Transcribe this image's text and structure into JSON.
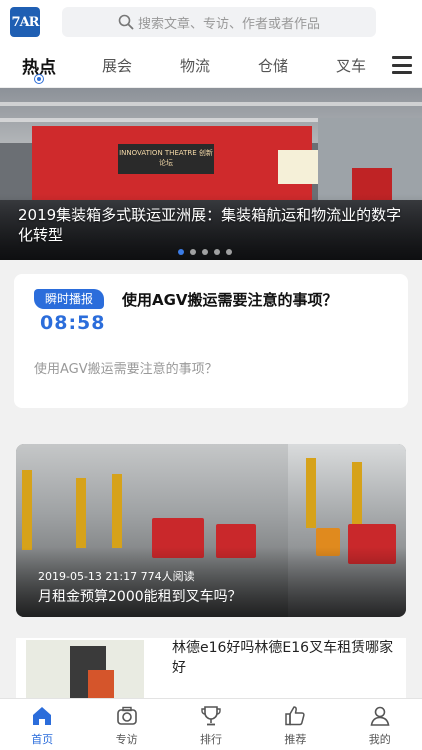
{
  "header": {
    "logo_text": "7AR",
    "search_placeholder": "搜索文章、专访、作者或者作品",
    "search_icon": "search-icon"
  },
  "tabs": [
    {
      "label": "热点",
      "active": true
    },
    {
      "label": "展会",
      "active": false
    },
    {
      "label": "物流",
      "active": false
    },
    {
      "label": "仓储",
      "active": false
    },
    {
      "label": "叉车",
      "active": false
    }
  ],
  "menu_icon": "hamburger-menu-icon",
  "banner": {
    "caption": "2019集装箱多式联运亚洲展：集装箱航运和物流业的数字化转型",
    "stage_sign": "INNOVATION THEATRE 创新论坛",
    "slide_count": 5,
    "active_slide": 1
  },
  "flash": {
    "badge": "瞬时播报",
    "time": "08:58",
    "title": "使用AGV搬运需要注意的事项？",
    "desc": "使用AGV搬运需要注意的事项？"
  },
  "articles": [
    {
      "meta": "2019-05-13 21:17 774人阅读",
      "title": "月租金预算2000能租到叉车吗？"
    },
    {
      "title": "林德e16好吗林德E16叉车租赁哪家好"
    }
  ],
  "bottom_nav": [
    {
      "label": "首页",
      "icon": "home-icon",
      "active": true
    },
    {
      "label": "专访",
      "icon": "camera-icon",
      "active": false
    },
    {
      "label": "排行",
      "icon": "trophy-icon",
      "active": false
    },
    {
      "label": "推荐",
      "icon": "thumbs-up-icon",
      "active": false
    },
    {
      "label": "我的",
      "icon": "user-icon",
      "active": false
    }
  ],
  "colors": {
    "accent": "#2b6ddb",
    "logo_bg": "#1f5fb3",
    "background": "#f1f1f1"
  }
}
